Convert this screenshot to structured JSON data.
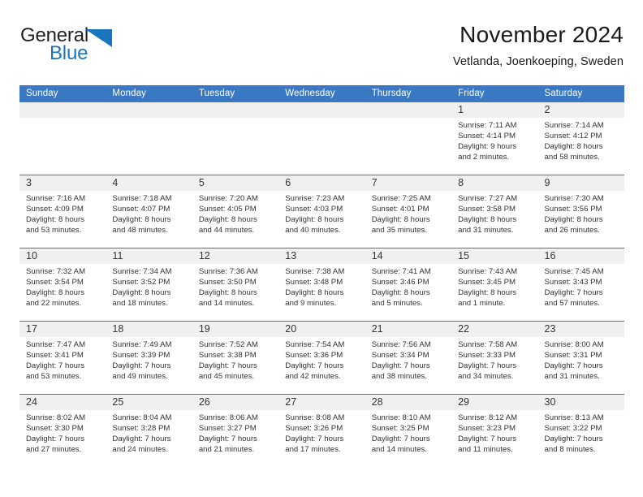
{
  "brand": {
    "word1": "General",
    "word2": "Blue",
    "triangle_color": "#1b75bc",
    "text_color": "#231f20"
  },
  "header": {
    "month_title": "November 2024",
    "location": "Vetlanda, Joenkoeping, Sweden"
  },
  "theme": {
    "header_blue": "#3b78c3",
    "row_divider_blue": "#3b78c3",
    "daynum_band": "#f0f0f0",
    "cell_background": "#ffffff",
    "text": "#333333"
  },
  "calendar": {
    "day_headers": [
      "Sunday",
      "Monday",
      "Tuesday",
      "Wednesday",
      "Thursday",
      "Friday",
      "Saturday"
    ],
    "weeks": [
      [
        {
          "day": "",
          "lines": []
        },
        {
          "day": "",
          "lines": []
        },
        {
          "day": "",
          "lines": []
        },
        {
          "day": "",
          "lines": []
        },
        {
          "day": "",
          "lines": []
        },
        {
          "day": "1",
          "lines": [
            "Sunrise: 7:11 AM",
            "Sunset: 4:14 PM",
            "Daylight: 9 hours",
            "and 2 minutes."
          ]
        },
        {
          "day": "2",
          "lines": [
            "Sunrise: 7:14 AM",
            "Sunset: 4:12 PM",
            "Daylight: 8 hours",
            "and 58 minutes."
          ]
        }
      ],
      [
        {
          "day": "3",
          "lines": [
            "Sunrise: 7:16 AM",
            "Sunset: 4:09 PM",
            "Daylight: 8 hours",
            "and 53 minutes."
          ]
        },
        {
          "day": "4",
          "lines": [
            "Sunrise: 7:18 AM",
            "Sunset: 4:07 PM",
            "Daylight: 8 hours",
            "and 48 minutes."
          ]
        },
        {
          "day": "5",
          "lines": [
            "Sunrise: 7:20 AM",
            "Sunset: 4:05 PM",
            "Daylight: 8 hours",
            "and 44 minutes."
          ]
        },
        {
          "day": "6",
          "lines": [
            "Sunrise: 7:23 AM",
            "Sunset: 4:03 PM",
            "Daylight: 8 hours",
            "and 40 minutes."
          ]
        },
        {
          "day": "7",
          "lines": [
            "Sunrise: 7:25 AM",
            "Sunset: 4:01 PM",
            "Daylight: 8 hours",
            "and 35 minutes."
          ]
        },
        {
          "day": "8",
          "lines": [
            "Sunrise: 7:27 AM",
            "Sunset: 3:58 PM",
            "Daylight: 8 hours",
            "and 31 minutes."
          ]
        },
        {
          "day": "9",
          "lines": [
            "Sunrise: 7:30 AM",
            "Sunset: 3:56 PM",
            "Daylight: 8 hours",
            "and 26 minutes."
          ]
        }
      ],
      [
        {
          "day": "10",
          "lines": [
            "Sunrise: 7:32 AM",
            "Sunset: 3:54 PM",
            "Daylight: 8 hours",
            "and 22 minutes."
          ]
        },
        {
          "day": "11",
          "lines": [
            "Sunrise: 7:34 AM",
            "Sunset: 3:52 PM",
            "Daylight: 8 hours",
            "and 18 minutes."
          ]
        },
        {
          "day": "12",
          "lines": [
            "Sunrise: 7:36 AM",
            "Sunset: 3:50 PM",
            "Daylight: 8 hours",
            "and 14 minutes."
          ]
        },
        {
          "day": "13",
          "lines": [
            "Sunrise: 7:38 AM",
            "Sunset: 3:48 PM",
            "Daylight: 8 hours",
            "and 9 minutes."
          ]
        },
        {
          "day": "14",
          "lines": [
            "Sunrise: 7:41 AM",
            "Sunset: 3:46 PM",
            "Daylight: 8 hours",
            "and 5 minutes."
          ]
        },
        {
          "day": "15",
          "lines": [
            "Sunrise: 7:43 AM",
            "Sunset: 3:45 PM",
            "Daylight: 8 hours",
            "and 1 minute."
          ]
        },
        {
          "day": "16",
          "lines": [
            "Sunrise: 7:45 AM",
            "Sunset: 3:43 PM",
            "Daylight: 7 hours",
            "and 57 minutes."
          ]
        }
      ],
      [
        {
          "day": "17",
          "lines": [
            "Sunrise: 7:47 AM",
            "Sunset: 3:41 PM",
            "Daylight: 7 hours",
            "and 53 minutes."
          ]
        },
        {
          "day": "18",
          "lines": [
            "Sunrise: 7:49 AM",
            "Sunset: 3:39 PM",
            "Daylight: 7 hours",
            "and 49 minutes."
          ]
        },
        {
          "day": "19",
          "lines": [
            "Sunrise: 7:52 AM",
            "Sunset: 3:38 PM",
            "Daylight: 7 hours",
            "and 45 minutes."
          ]
        },
        {
          "day": "20",
          "lines": [
            "Sunrise: 7:54 AM",
            "Sunset: 3:36 PM",
            "Daylight: 7 hours",
            "and 42 minutes."
          ]
        },
        {
          "day": "21",
          "lines": [
            "Sunrise: 7:56 AM",
            "Sunset: 3:34 PM",
            "Daylight: 7 hours",
            "and 38 minutes."
          ]
        },
        {
          "day": "22",
          "lines": [
            "Sunrise: 7:58 AM",
            "Sunset: 3:33 PM",
            "Daylight: 7 hours",
            "and 34 minutes."
          ]
        },
        {
          "day": "23",
          "lines": [
            "Sunrise: 8:00 AM",
            "Sunset: 3:31 PM",
            "Daylight: 7 hours",
            "and 31 minutes."
          ]
        }
      ],
      [
        {
          "day": "24",
          "lines": [
            "Sunrise: 8:02 AM",
            "Sunset: 3:30 PM",
            "Daylight: 7 hours",
            "and 27 minutes."
          ]
        },
        {
          "day": "25",
          "lines": [
            "Sunrise: 8:04 AM",
            "Sunset: 3:28 PM",
            "Daylight: 7 hours",
            "and 24 minutes."
          ]
        },
        {
          "day": "26",
          "lines": [
            "Sunrise: 8:06 AM",
            "Sunset: 3:27 PM",
            "Daylight: 7 hours",
            "and 21 minutes."
          ]
        },
        {
          "day": "27",
          "lines": [
            "Sunrise: 8:08 AM",
            "Sunset: 3:26 PM",
            "Daylight: 7 hours",
            "and 17 minutes."
          ]
        },
        {
          "day": "28",
          "lines": [
            "Sunrise: 8:10 AM",
            "Sunset: 3:25 PM",
            "Daylight: 7 hours",
            "and 14 minutes."
          ]
        },
        {
          "day": "29",
          "lines": [
            "Sunrise: 8:12 AM",
            "Sunset: 3:23 PM",
            "Daylight: 7 hours",
            "and 11 minutes."
          ]
        },
        {
          "day": "30",
          "lines": [
            "Sunrise: 8:13 AM",
            "Sunset: 3:22 PM",
            "Daylight: 7 hours",
            "and 8 minutes."
          ]
        }
      ]
    ]
  }
}
